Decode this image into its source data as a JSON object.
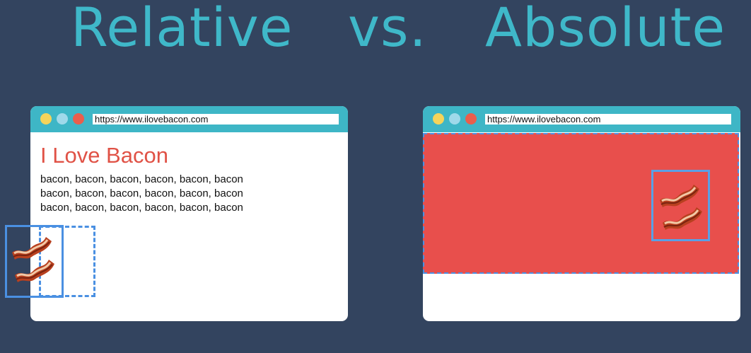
{
  "headings": {
    "left": "Relative",
    "middle": "vs.",
    "right": "Absolute"
  },
  "left_browser": {
    "url": "https://www.ilovebacon.com",
    "title": "I Love Bacon",
    "body_lines": [
      "bacon, bacon, bacon, bacon, bacon, bacon",
      "bacon, bacon, bacon, bacon, bacon, bacon",
      "bacon, bacon, bacon, bacon, bacon, bacon"
    ]
  },
  "right_browser": {
    "url": "https://www.ilovebacon.com"
  },
  "icons": {
    "bacon": "bacon-icon",
    "window_dots": [
      "yellow-dot-icon",
      "blue-dot-icon",
      "red-dot-icon"
    ]
  },
  "colors": {
    "background": "#33445f",
    "heading": "#3fb8c9",
    "titlebar": "#3eb6c6",
    "page_title": "#e05246",
    "red_block": "#e84f4c",
    "outline_blue": "#4a90e2"
  }
}
